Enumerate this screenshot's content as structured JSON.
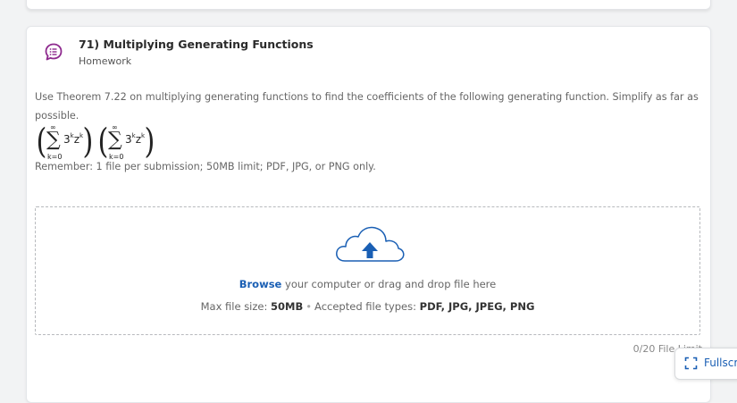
{
  "question": {
    "number_title": "71) Multiplying Generating Functions",
    "type": "Homework",
    "text": "Use Theorem 7.22 on multiplying generating functions to find the coefficients of the following generating function. Simplify as far as possible.",
    "math": {
      "sum_upper": "∞",
      "sum_lower": "k=0",
      "term_base": "3",
      "term_exp1": "k",
      "term_var": "z",
      "term_exp2": "k"
    },
    "remember": "Remember: 1 file per submission; 50MB limit; PDF, JPG, or PNG only."
  },
  "upload": {
    "browse_label": "Browse",
    "browse_rest": " your computer or drag and drop file here",
    "max_size_label": "Max file size: ",
    "max_size_value": "50MB",
    "accepted_label": "Accepted file types: ",
    "accepted_value": "PDF, JPG, JPEG, PNG",
    "file_limit": "0/20 File Limit"
  },
  "fullscreen_label": "Fullscreen",
  "colors": {
    "accent": "#1a5fb4",
    "icon_purple": "#8e2a8e",
    "cloud_fill": "#ffffff",
    "arrow_blue": "#1a5fb4"
  },
  "icons": {
    "homework": "list-bubble-icon",
    "upload": "cloud-upload-icon",
    "fullscreen": "fullscreen-icon"
  }
}
